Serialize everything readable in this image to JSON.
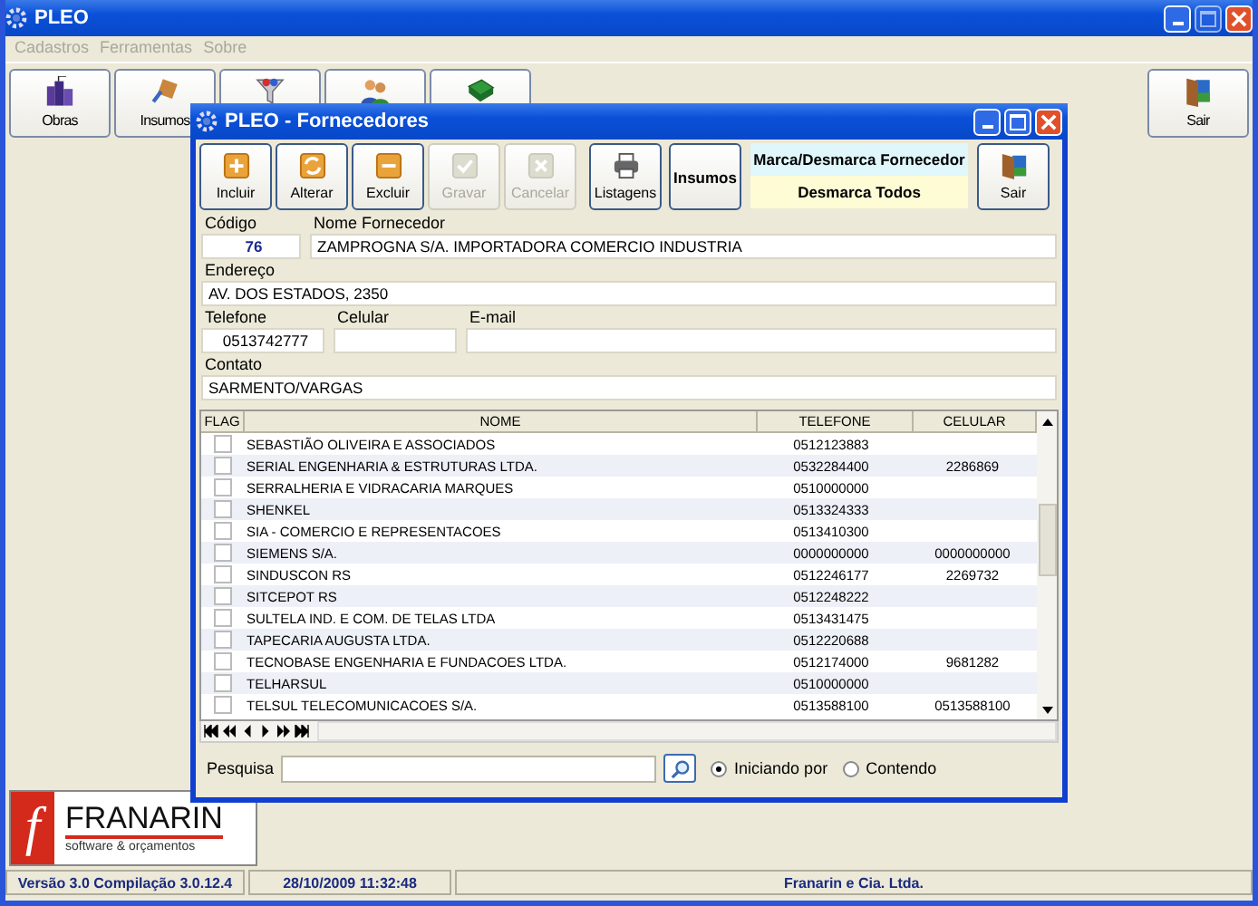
{
  "window": {
    "title": "PLEO"
  },
  "menu": [
    {
      "label": "Cadastros",
      "disabled": true
    },
    {
      "label": "Ferramentas",
      "disabled": true
    },
    {
      "label": "Sobre",
      "disabled": true
    }
  ],
  "toolbar": [
    {
      "kind": "buildings",
      "label": "Obras"
    },
    {
      "kind": "paint",
      "label": "Insumos"
    },
    {
      "kind": "funnel"
    },
    {
      "kind": "people"
    },
    {
      "kind": "book"
    }
  ],
  "exit_button": {
    "label": "Sair"
  },
  "dialog": {
    "title": "PLEO - Fornecedores",
    "buttons": [
      {
        "kind": "add",
        "label": "Incluir",
        "disabled": false
      },
      {
        "kind": "edit",
        "label": "Alterar",
        "disabled": false
      },
      {
        "kind": "remove",
        "label": "Excluir",
        "disabled": false
      },
      {
        "kind": "save",
        "label": "Gravar",
        "disabled": true
      },
      {
        "kind": "cancel",
        "label": "Cancelar",
        "disabled": true
      }
    ],
    "listagens_button": {
      "label": "Listagens"
    },
    "insumos_button": {
      "label": "Insumos"
    },
    "mark_button": {
      "label": "Marca/Desmarca Fornecedor"
    },
    "unmark_button": {
      "label": "Desmarca Todos"
    },
    "exit_button": {
      "label": "Sair"
    },
    "fields": {
      "codigo": {
        "label": "Código",
        "value": "76"
      },
      "nome": {
        "label": "Nome Fornecedor",
        "value": "ZAMPROGNA S/A. IMPORTADORA COMERCIO INDUSTRIA"
      },
      "endereco": {
        "label": "Endereço",
        "value": "AV. DOS ESTADOS, 2350"
      },
      "telefone": {
        "label": "Telefone",
        "value": "0513742777"
      },
      "celular": {
        "label": "Celular"
      },
      "email": {
        "label": "E-mail"
      },
      "contato": {
        "label": "Contato",
        "value": "SARMENTO/VARGAS"
      }
    },
    "table": {
      "columns": [
        "FLAG",
        "NOME",
        "TELEFONE",
        "CELULAR"
      ],
      "rows": [
        {
          "checked": false,
          "nome": "SEBASTIÃO OLIVEIRA E ASSOCIADOS",
          "telefone": "0512123883"
        },
        {
          "checked": false,
          "nome": "SERIAL ENGENHARIA & ESTRUTURAS LTDA.",
          "telefone": "0532284400",
          "celular": "2286869"
        },
        {
          "checked": false,
          "nome": "SERRALHERIA E VIDRACARIA MARQUES",
          "telefone": "0510000000"
        },
        {
          "checked": false,
          "nome": "SHENKEL",
          "telefone": "0513324333"
        },
        {
          "checked": false,
          "nome": "SIA - COMERCIO E REPRESENTACOES",
          "telefone": "0513410300"
        },
        {
          "checked": false,
          "nome": "SIEMENS S/A.",
          "telefone": "0000000000",
          "celular": "0000000000"
        },
        {
          "checked": false,
          "nome": "SINDUSCON RS",
          "telefone": "0512246177",
          "celular": "2269732"
        },
        {
          "checked": false,
          "nome": "SITCEPOT RS",
          "telefone": "0512248222"
        },
        {
          "checked": false,
          "nome": "SULTELA  IND. E COM. DE TELAS LTDA",
          "telefone": "0513431475"
        },
        {
          "checked": false,
          "nome": "TAPECARIA AUGUSTA LTDA.",
          "telefone": "0512220688"
        },
        {
          "checked": false,
          "nome": "TECNOBASE ENGENHARIA E FUNDACOES LTDA.",
          "telefone": "0512174000",
          "celular": "9681282"
        },
        {
          "checked": false,
          "nome": "TELHARSUL",
          "telefone": "0510000000"
        },
        {
          "checked": false,
          "nome": "TELSUL TELECOMUNICACOES S/A.",
          "telefone": "0513588100",
          "celular": "0513588100"
        }
      ]
    },
    "search": {
      "label": "Pesquisa",
      "options": [
        {
          "label": "Iniciando por",
          "selected": true
        },
        {
          "label": "Contendo",
          "selected": false
        }
      ]
    }
  },
  "logo": {
    "mark": "f",
    "name": "FRANARIN",
    "tagline": "software & orçamentos"
  },
  "status_bar": [
    "Versão 3.0 Compilação 3.0.12.4",
    "28/10/2009 11:32:48",
    "Franarin e Cia. Ltda."
  ]
}
